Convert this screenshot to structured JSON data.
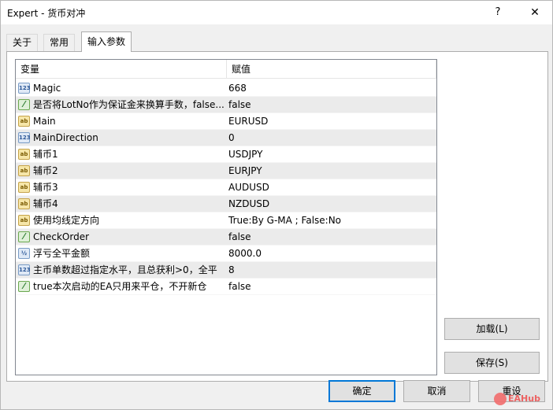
{
  "window": {
    "title": "Expert - 货币对冲",
    "help": "?",
    "close": "✕"
  },
  "tabs": [
    {
      "label": "关于",
      "active": false
    },
    {
      "label": "常用",
      "active": false
    },
    {
      "label": "输入参数",
      "active": true
    }
  ],
  "grid": {
    "headers": {
      "variable": "变量",
      "value": "赋值"
    },
    "rows": [
      {
        "icon": "int-icon",
        "icon_text": "123",
        "name": "Magic",
        "value": "668"
      },
      {
        "icon": "bool-icon",
        "icon_text": "⁄",
        "name": "是否将LotNo作为保证金来换算手数，false...",
        "value": "false"
      },
      {
        "icon": "string-icon",
        "icon_text": "ab",
        "name": "Main",
        "value": "EURUSD"
      },
      {
        "icon": "int-icon",
        "icon_text": "123",
        "name": "MainDirection",
        "value": "0"
      },
      {
        "icon": "string-icon",
        "icon_text": "ab",
        "name": "辅币1",
        "value": "USDJPY"
      },
      {
        "icon": "string-icon",
        "icon_text": "ab",
        "name": "辅币2",
        "value": "EURJPY"
      },
      {
        "icon": "string-icon",
        "icon_text": "ab",
        "name": "辅币3",
        "value": "AUDUSD"
      },
      {
        "icon": "string-icon",
        "icon_text": "ab",
        "name": "辅币4",
        "value": "NZDUSD"
      },
      {
        "icon": "string-icon",
        "icon_text": "ab",
        "name": "使用均线定方向",
        "value": "True:By G-MA ;    False:No"
      },
      {
        "icon": "bool-icon",
        "icon_text": "⁄",
        "name": "CheckOrder",
        "value": "false"
      },
      {
        "icon": "double-icon",
        "icon_text": "½",
        "name": "浮亏全平金额",
        "value": "8000.0"
      },
      {
        "icon": "int-icon",
        "icon_text": "123",
        "name": "主币单数超过指定水平，且总获利>0，全平",
        "value": "8"
      },
      {
        "icon": "bool-icon",
        "icon_text": "⁄",
        "name": "true本次启动的EA只用来平仓，不开新仓",
        "value": "false"
      }
    ]
  },
  "side_buttons": {
    "load": "加载(L)",
    "save": "保存(S)"
  },
  "footer_buttons": {
    "ok": "确定",
    "cancel": "取消",
    "reset": "重设"
  },
  "watermark": "EAHub"
}
